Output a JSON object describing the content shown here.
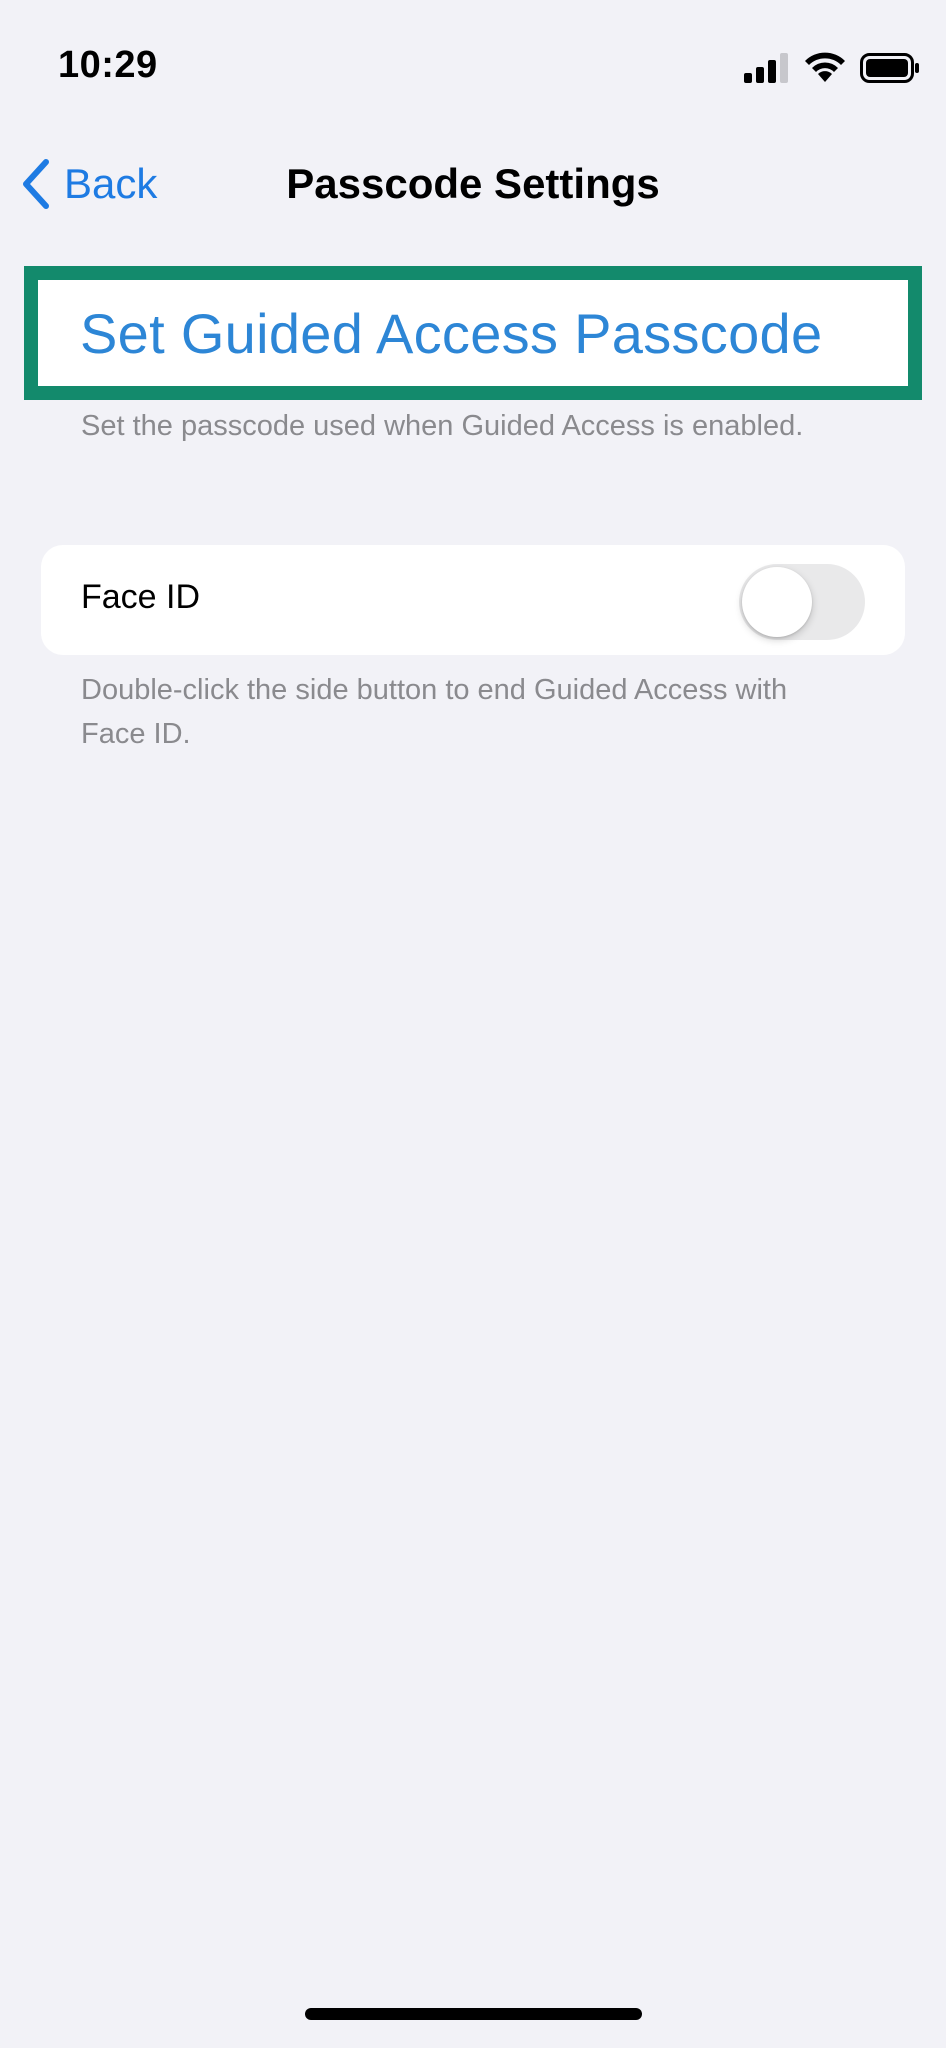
{
  "status_bar": {
    "time": "10:29",
    "icons": [
      "cellular-signal-icon",
      "wifi-icon",
      "battery-icon"
    ]
  },
  "nav": {
    "back_label": "Back",
    "title": "Passcode Settings"
  },
  "passcode": {
    "row_label": "Set Guided Access Passcode",
    "footer": "Set the passcode used when Guided Access is enabled."
  },
  "face_id": {
    "label": "Face ID",
    "enabled": false,
    "footer": "Double-click the side button to end Guided Access with Face ID."
  },
  "colors": {
    "accent": "#1e7be3",
    "highlight_border": "#138a6c",
    "background": "#f2f2f7",
    "secondary_text": "#8a8a8e"
  }
}
